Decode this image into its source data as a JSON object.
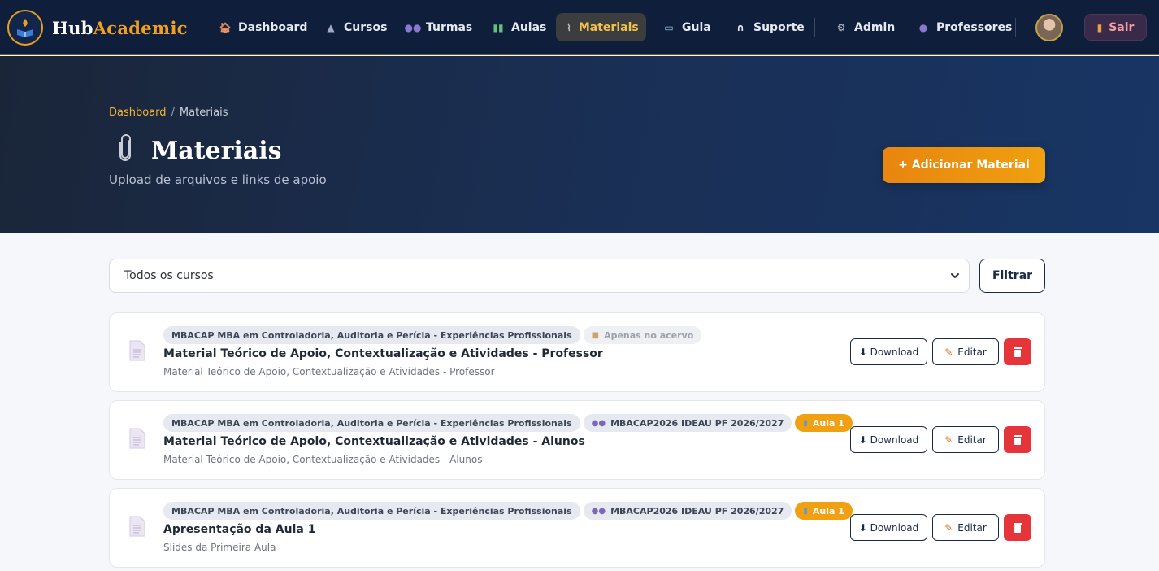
{
  "brand": {
    "name_part1": "Hub",
    "name_part2": "Academic"
  },
  "nav": {
    "items": [
      {
        "label": "Dashboard",
        "icon": "house-icon"
      },
      {
        "label": "Cursos",
        "icon": "graduation-icon"
      },
      {
        "label": "Turmas",
        "icon": "people-icon"
      },
      {
        "label": "Aulas",
        "icon": "books-icon"
      },
      {
        "label": "Materiais",
        "icon": "paperclip-icon",
        "active": true
      },
      {
        "label": "Guia",
        "icon": "open-book-icon"
      },
      {
        "label": "Suporte",
        "icon": "headset-icon"
      },
      {
        "label": "Admin",
        "icon": "gear-icon"
      },
      {
        "label": "Professores",
        "icon": "person-icon"
      }
    ],
    "logout_label": "Sair"
  },
  "hero": {
    "breadcrumb_home": "Dashboard",
    "breadcrumb_separator": "/",
    "breadcrumb_current": "Materiais",
    "title": "Materiais",
    "subtitle": "Upload de arquivos e links de apoio",
    "add_button": "+ Adicionar Material"
  },
  "filter": {
    "selected_course": "Todos os cursos",
    "button_label": "Filtrar"
  },
  "materials": [
    {
      "course": "MBACAP MBA em Controladoria, Auditoria e Perícia - Experiências Profissionais",
      "archive_badge": "Apenas no acervo",
      "title": "Material Teórico de Apoio, Contextualização e Atividades - Professor",
      "description": "Material Teórico de Apoio, Contextualização e Atividades - Professor"
    },
    {
      "course": "MBACAP MBA em Controladoria, Auditoria e Perícia - Experiências Profissionais",
      "class": "MBACAP2026 IDEAU PF 2026/2027",
      "lesson": "Aula 1",
      "title": "Material Teórico de Apoio, Contextualização e Atividades - Alunos",
      "description": "Material Teórico de Apoio, Contextualização e Atividades - Alunos"
    },
    {
      "course": "MBACAP MBA em Controladoria, Auditoria e Perícia - Experiências Profissionais",
      "class": "MBACAP2026 IDEAU PF 2026/2027",
      "lesson": "Aula 1",
      "title": "Apresentação da Aula 1",
      "description": "Slides da Primeira Aula"
    }
  ],
  "actions": {
    "download": "⬇ Download",
    "edit": "Editar"
  },
  "colors": {
    "navbar": "#0f1e3a",
    "accent": "#f0a010",
    "danger": "#e5343a",
    "navy": "#1a2b4a"
  }
}
